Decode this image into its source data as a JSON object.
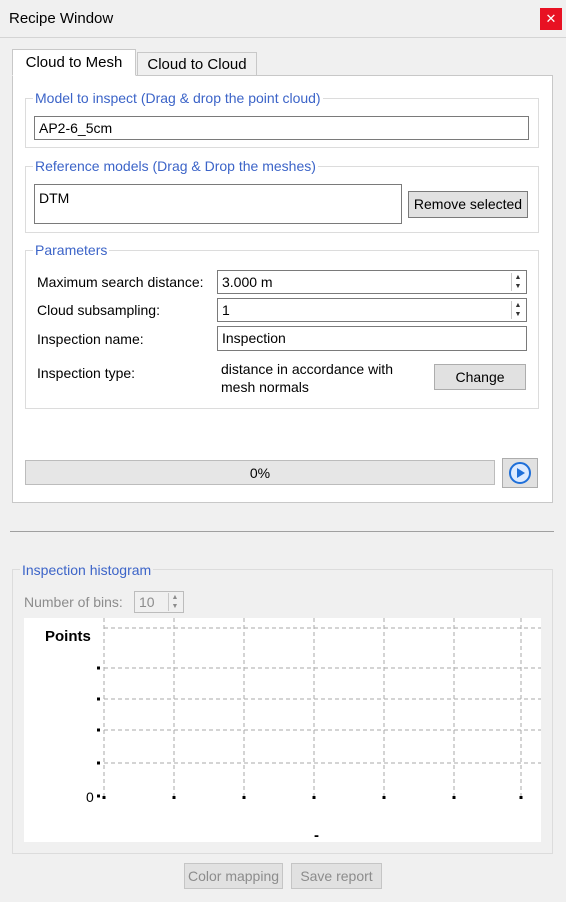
{
  "window": {
    "title": "Recipe Window",
    "close_glyph": "✕"
  },
  "tabs": [
    {
      "label": "Cloud to Mesh",
      "active": true
    },
    {
      "label": "Cloud to Cloud",
      "active": false
    }
  ],
  "model_group": {
    "title": "Model to inspect (Drag & drop the point cloud)",
    "value": "AP2-6_5cm"
  },
  "reference_group": {
    "title": "Reference models (Drag & Drop the meshes)",
    "items": [
      "DTM"
    ],
    "remove_label": "Remove selected"
  },
  "parameters": {
    "title": "Parameters",
    "max_distance_label": "Maximum search distance:",
    "max_distance_value": "3.000 m",
    "subsampling_label": "Cloud subsampling:",
    "subsampling_value": "1",
    "name_label": "Inspection name:",
    "name_value": "Inspection",
    "type_label": "Inspection type:",
    "type_value_line1": "distance in accordance with",
    "type_value_line2": "mesh normals",
    "change_label": "Change"
  },
  "progress": {
    "text": "0%",
    "fraction": 0
  },
  "run_button": {
    "icon": "play-icon"
  },
  "histogram": {
    "title": "Inspection histogram",
    "bins_label": "Number of bins:",
    "bins_value": "10"
  },
  "chart_data": {
    "type": "bar",
    "ylabel": "Points",
    "xlabel": "-",
    "y_tick_labels": [
      "0"
    ],
    "values": [],
    "grid": true
  },
  "footer": {
    "color_mapping_label": "Color mapping",
    "save_report_label": "Save report"
  },
  "colors": {
    "accent_text": "#3c64c8",
    "close_button": "#e81123",
    "play_icon": "#1e6fd9"
  }
}
